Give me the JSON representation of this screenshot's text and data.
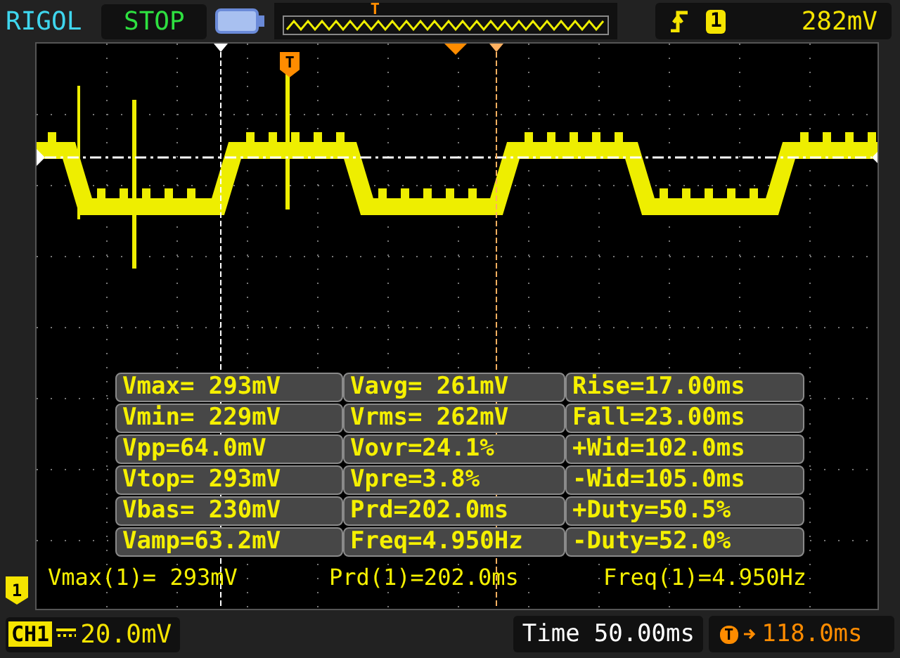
{
  "top_bar": {
    "brand": "RIGOL",
    "run_state": "STOP",
    "memory_trigger_marker": "T",
    "trigger": {
      "channel": "1",
      "voltage": "282mV"
    }
  },
  "display": {
    "trigger_marker": "T",
    "channel_marker": "1",
    "measurements": [
      [
        "Vmax= 293mV",
        "Vavg= 261mV",
        "Rise=17.00ms"
      ],
      [
        "Vmin= 229mV",
        "Vrms= 262mV",
        "Fall=23.00ms"
      ],
      [
        "Vpp=64.0mV",
        "Vovr=24.1%",
        "+Wid=102.0ms"
      ],
      [
        "Vtop= 293mV",
        "Vpre=3.8%",
        "-Wid=105.0ms"
      ],
      [
        "Vbas= 230mV",
        "Prd=202.0ms",
        "+Duty=50.5%"
      ],
      [
        "Vamp=63.2mV",
        "Freq=4.950Hz",
        "-Duty=52.0%"
      ]
    ],
    "readouts": [
      "Vmax(1)= 293mV",
      "Prd(1)=202.0ms",
      "Freq(1)=4.950Hz"
    ]
  },
  "status_bar": {
    "channel": "CH1",
    "scale": "20.0mV",
    "time_label": "Time",
    "time_scale": "50.00ms",
    "trigger_marker": "T",
    "trigger_offset": "118.0ms"
  }
}
